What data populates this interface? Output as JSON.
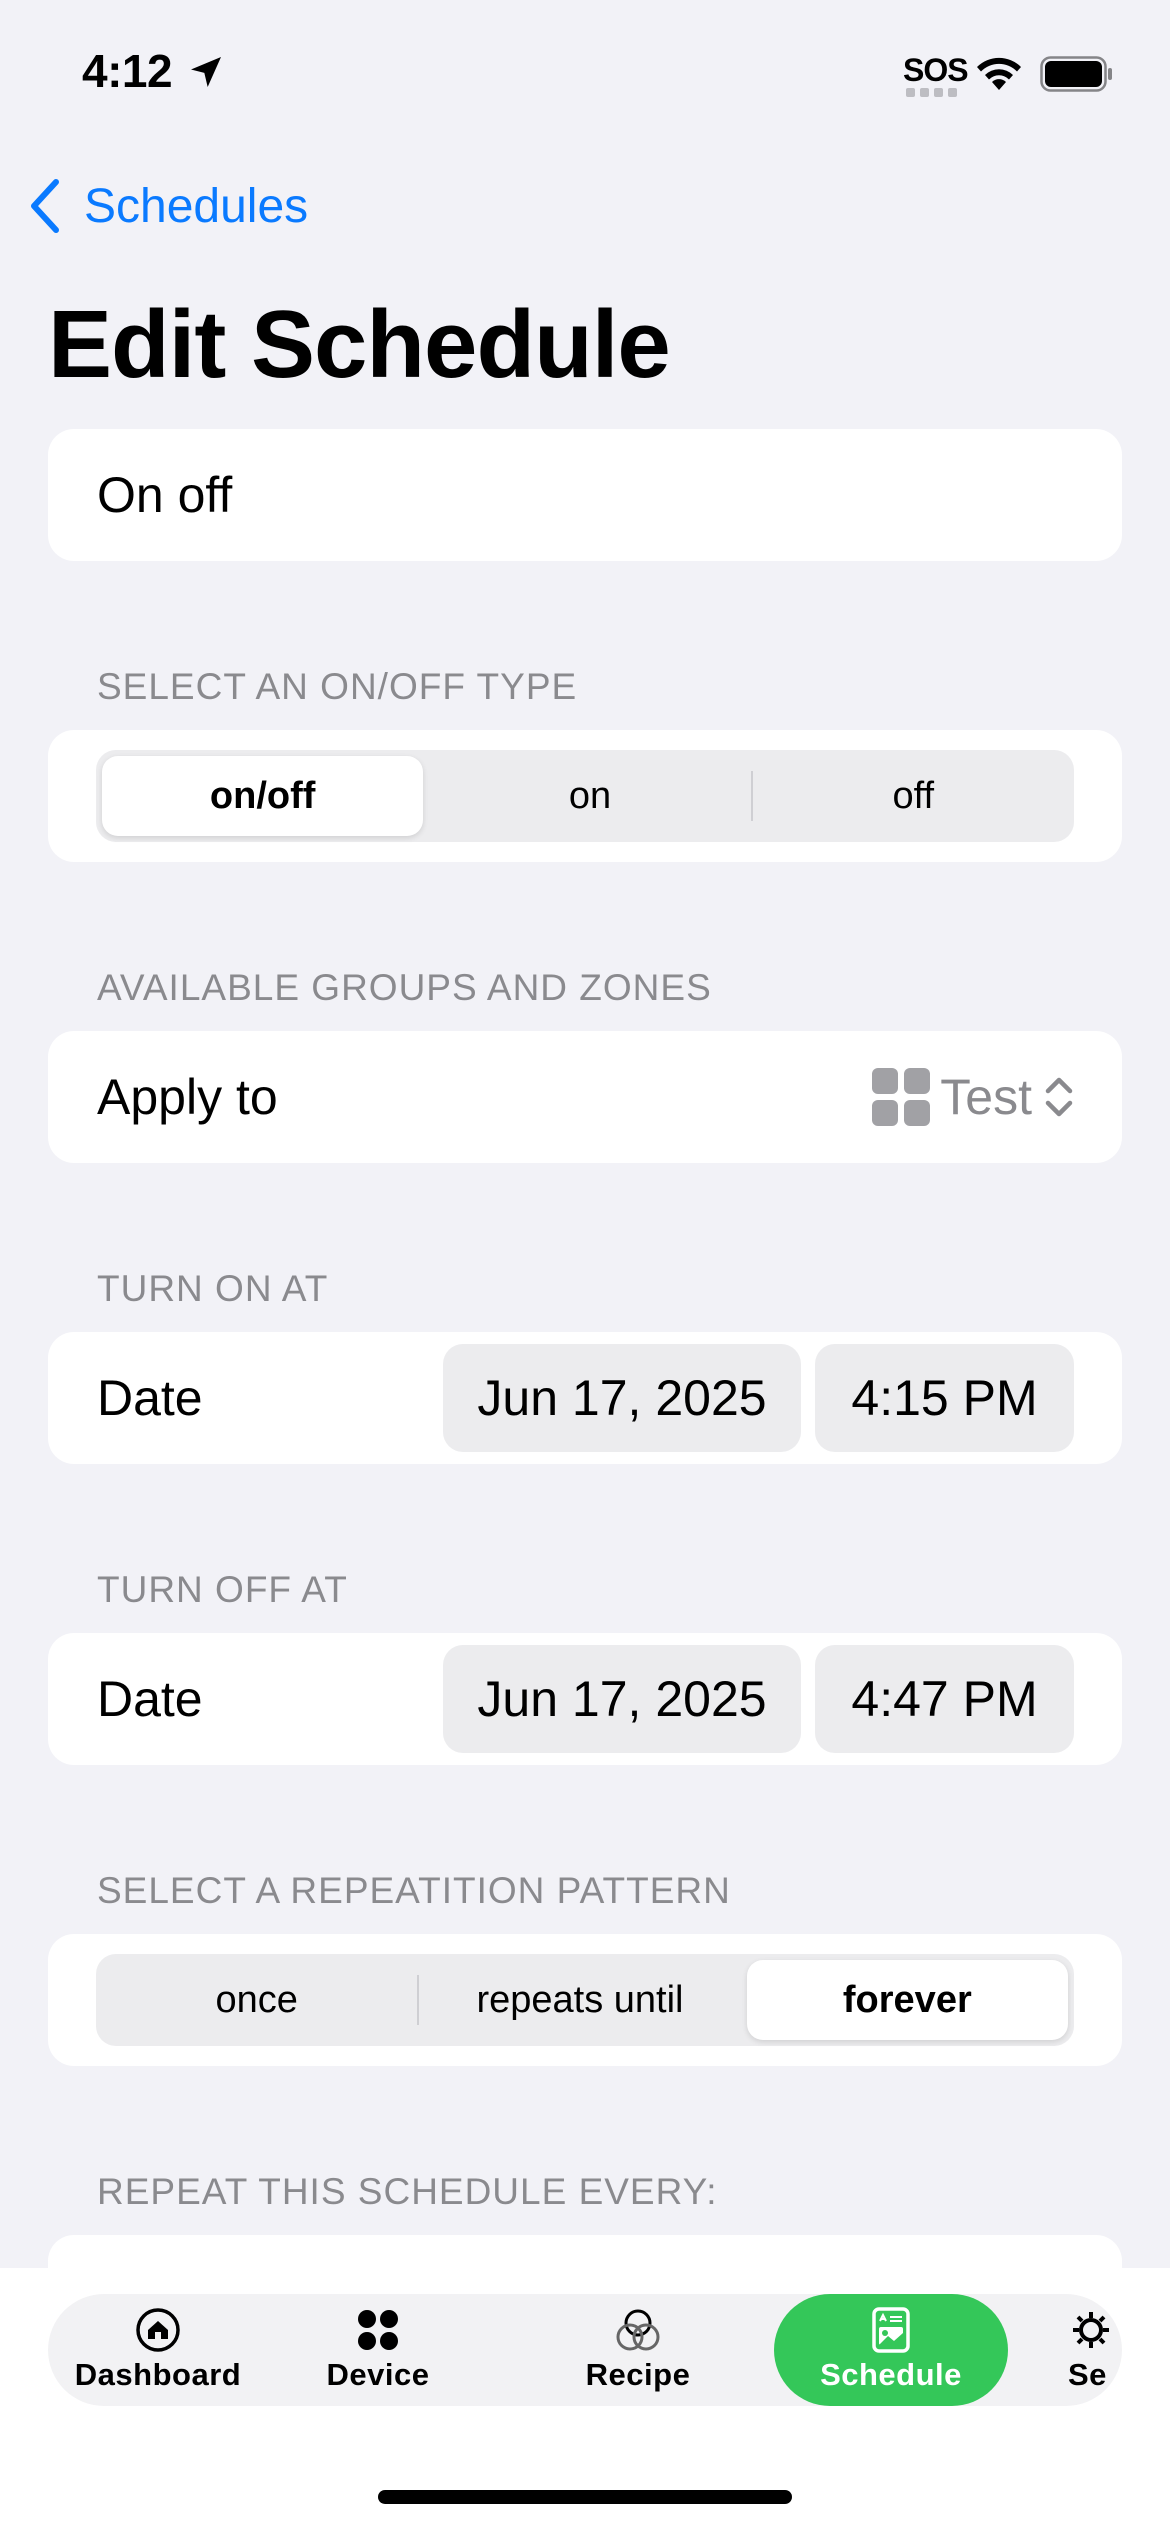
{
  "status_bar": {
    "time": "4:12",
    "sos": "SOS"
  },
  "nav": {
    "back_label": "Schedules",
    "title": "Edit Schedule"
  },
  "name_field": {
    "value": "On off"
  },
  "onoff_section": {
    "header": "SELECT AN ON/OFF TYPE",
    "options": [
      "on/off",
      "on",
      "off"
    ],
    "selected": "on/off"
  },
  "groups_section": {
    "header": "AVAILABLE GROUPS AND ZONES",
    "label": "Apply to",
    "value": "Test"
  },
  "turn_on": {
    "header": "TURN ON AT",
    "label": "Date",
    "date": "Jun 17, 2025",
    "time": "4:15 PM"
  },
  "turn_off": {
    "header": "TURN OFF AT",
    "label": "Date",
    "date": "Jun 17, 2025",
    "time": "4:47 PM"
  },
  "repetition_section": {
    "header": "SELECT A REPEATITION PATTERN",
    "options": [
      "once",
      "repeats until",
      "forever"
    ],
    "selected": "forever"
  },
  "repeat_every": {
    "header": "REPEAT THIS SCHEDULE EVERY:"
  },
  "tabbar": {
    "tabs": [
      {
        "label": "Dashboard",
        "icon": "home-icon"
      },
      {
        "label": "Device",
        "icon": "device-grid-icon"
      },
      {
        "label": "Recipe",
        "icon": "recipe-icon"
      },
      {
        "label": "Schedule",
        "icon": "schedule-icon"
      },
      {
        "label": "Se",
        "icon": "settings-icon"
      }
    ],
    "active": "Schedule"
  },
  "colors": {
    "accent_blue": "#0a7aff",
    "active_tab_green": "#34c759",
    "background": "#f2f2f7"
  }
}
